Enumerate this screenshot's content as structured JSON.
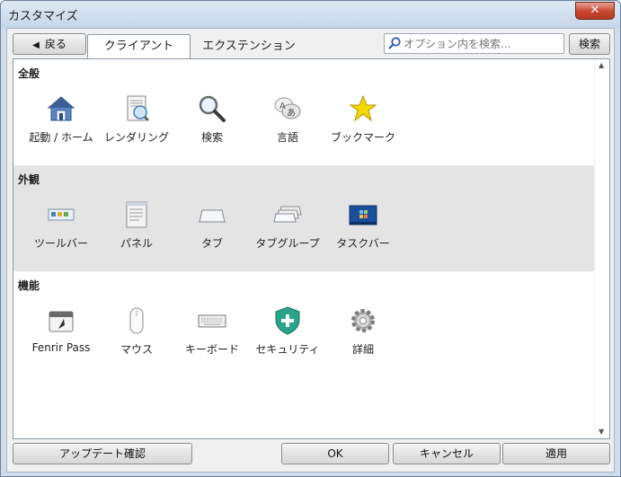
{
  "window": {
    "title": "カスタマイズ",
    "close_label": "✕"
  },
  "toolbar": {
    "back_label": "戻る",
    "back_icon": "back-arrow-icon"
  },
  "tabs": [
    {
      "label": "クライアント",
      "active": true
    },
    {
      "label": "エクステンション",
      "active": false
    }
  ],
  "search": {
    "placeholder": "オプション内を検索...",
    "value": "",
    "button_label": "検索"
  },
  "sections": [
    {
      "title": "全般",
      "items": [
        {
          "label": "起動 / ホーム",
          "icon": "home-icon"
        },
        {
          "label": "レンダリング",
          "icon": "rendering-icon"
        },
        {
          "label": "検索",
          "icon": "magnifier-icon"
        },
        {
          "label": "言語",
          "icon": "language-icon"
        },
        {
          "label": "ブックマーク",
          "icon": "star-icon"
        }
      ]
    },
    {
      "title": "外観",
      "items": [
        {
          "label": "ツールバー",
          "icon": "toolbar-icon"
        },
        {
          "label": "パネル",
          "icon": "panel-icon"
        },
        {
          "label": "タブ",
          "icon": "tab-icon"
        },
        {
          "label": "タブグループ",
          "icon": "tab-group-icon"
        },
        {
          "label": "タスクバー",
          "icon": "taskbar-icon"
        }
      ]
    },
    {
      "title": "機能",
      "items": [
        {
          "label": "Fenrir Pass",
          "icon": "fenrir-pass-icon"
        },
        {
          "label": "マウス",
          "icon": "mouse-icon"
        },
        {
          "label": "キーボード",
          "icon": "keyboard-icon"
        },
        {
          "label": "セキュリティ",
          "icon": "shield-icon"
        },
        {
          "label": "詳細",
          "icon": "gear-icon"
        }
      ]
    }
  ],
  "footer": {
    "update_label": "アップデート確認",
    "ok_label": "OK",
    "cancel_label": "キャンセル",
    "apply_label": "適用"
  },
  "colors": {
    "title_bar": "#c6d6ea",
    "close_button": "#c8442e",
    "section_alt_bg": "#e4e4e4",
    "star": "#f5d800",
    "shield": "#2aa58a",
    "taskbar": "#1a4f9c"
  }
}
